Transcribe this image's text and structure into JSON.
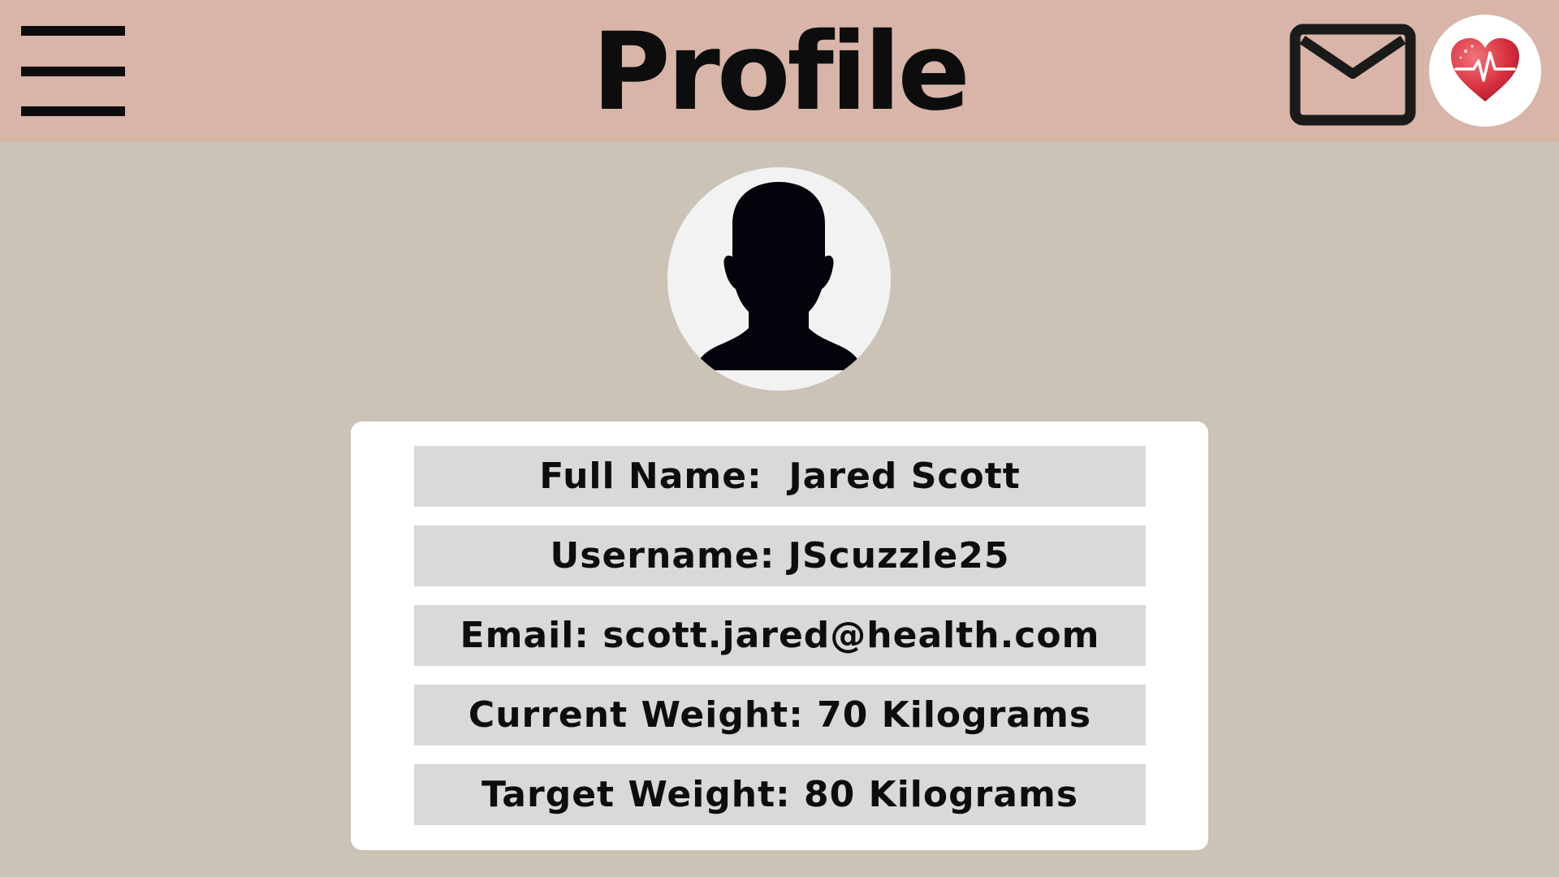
{
  "header": {
    "title": "Profile",
    "menu_icon": "hamburger-menu-icon",
    "mail_icon": "envelope-icon",
    "health_icon": "heart-pulse-icon",
    "background_color": "#d9b4a8"
  },
  "avatar": {
    "icon": "person-silhouette-icon"
  },
  "profile": {
    "rows": [
      {
        "text": "Full Name:  Jared Scott"
      },
      {
        "text": "Username: JScuzzle25"
      },
      {
        "text": "Email: scott.jared@health.com"
      },
      {
        "text": "Current Weight: 70 Kilograms"
      },
      {
        "text": "Target Weight: 80 Kilograms"
      }
    ]
  },
  "colors": {
    "page_background": "#cbc3b5",
    "card_background": "#ffffff",
    "row_background": "#d9d9d9",
    "heart": "#d8323f"
  }
}
